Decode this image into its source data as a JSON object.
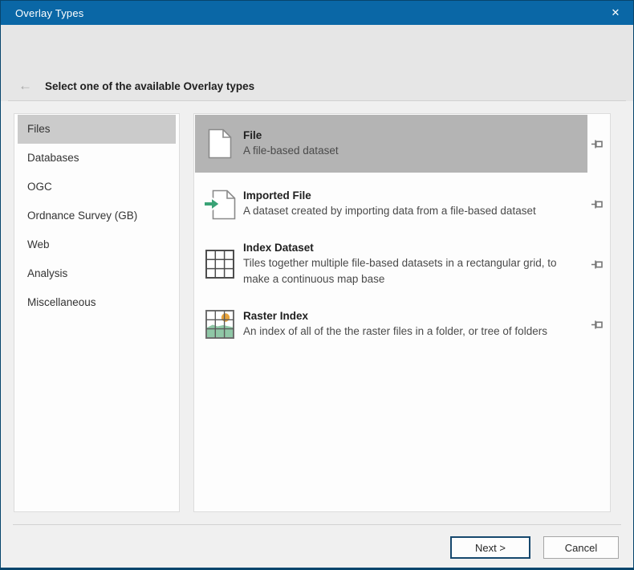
{
  "window": {
    "title": "Overlay Types",
    "close_glyph": "✕"
  },
  "header": {
    "back_glyph": "←",
    "title": "Select one of the available Overlay types"
  },
  "categories": {
    "items": [
      {
        "label": "Files",
        "selected": true
      },
      {
        "label": "Databases",
        "selected": false
      },
      {
        "label": "OGC",
        "selected": false
      },
      {
        "label": "Ordnance Survey (GB)",
        "selected": false
      },
      {
        "label": "Web",
        "selected": false
      },
      {
        "label": "Analysis",
        "selected": false
      },
      {
        "label": "Miscellaneous",
        "selected": false
      }
    ]
  },
  "overlay_types": [
    {
      "name": "File",
      "description": "A file-based dataset",
      "icon": "file-icon",
      "selected": true
    },
    {
      "name": "Imported File",
      "description": "A dataset created by importing data from a file-based dataset",
      "icon": "imported-file-icon",
      "selected": false
    },
    {
      "name": "Index Dataset",
      "description": "Tiles together multiple file-based datasets in a rectangular grid, to make a continuous map base",
      "icon": "index-dataset-icon",
      "selected": false
    },
    {
      "name": "Raster Index",
      "description": "An index of all of the the raster files in a folder, or tree of folders",
      "icon": "raster-index-icon",
      "selected": false
    }
  ],
  "footer": {
    "next_label": "Next >",
    "cancel_label": "Cancel"
  },
  "colors": {
    "titlebar_blue": "#0a67a6",
    "window_border": "#07456c",
    "header_gray": "#e6e6e6",
    "body_gray": "#f0f0f0",
    "sidebar_selected_gray": "#cbcbcb",
    "row_selected_gray": "#b4b4b4",
    "arrow_green": "#3aa376",
    "sun_orange": "#e8a33c",
    "hill_green": "#8fc7a6",
    "pin_gray": "#757575"
  }
}
